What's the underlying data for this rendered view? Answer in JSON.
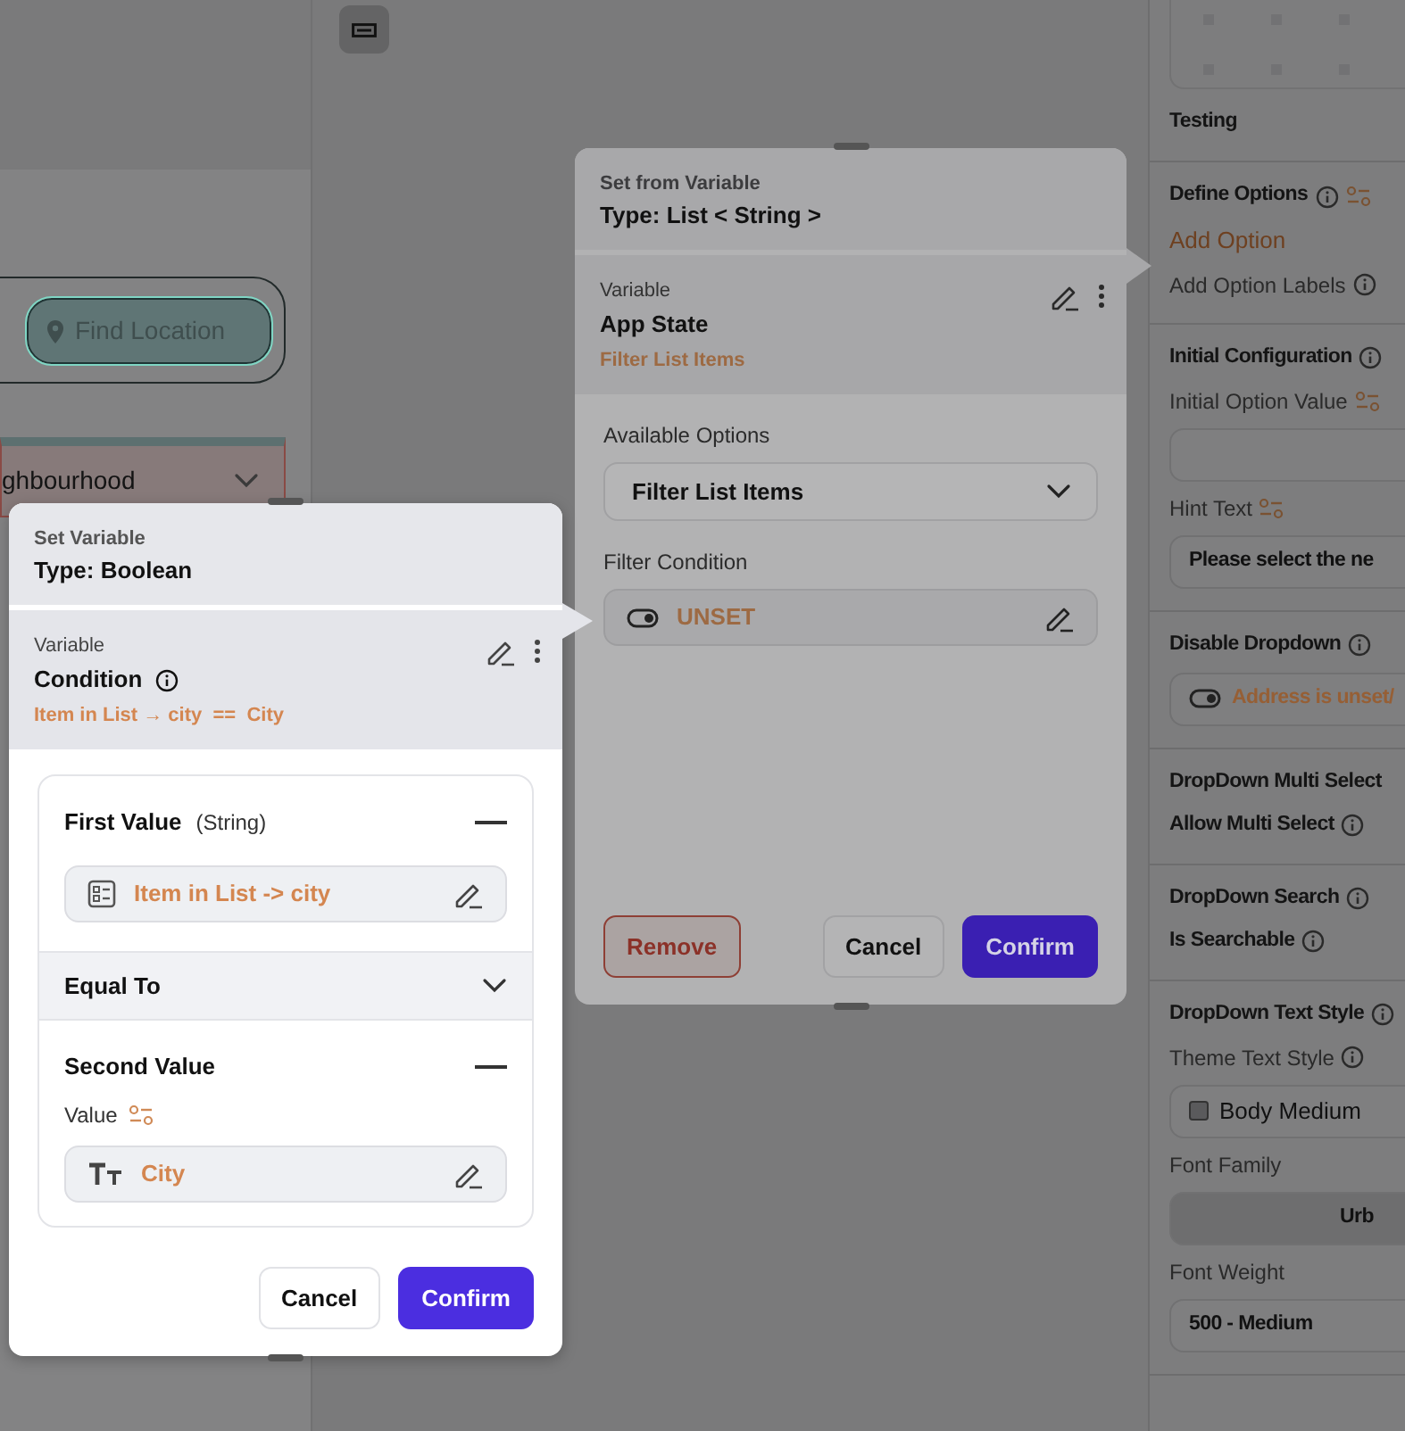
{
  "canvas": {
    "find_location_button": "Find Location",
    "dropdown": {
      "value": "ghbourhood"
    }
  },
  "properties_panel": {
    "sections": [
      {
        "items": [
          {
            "kind": "heading",
            "text": "Testing"
          }
        ]
      },
      {
        "items": [
          {
            "kind": "heading",
            "text": "Define Options",
            "info": true,
            "options_icon": true
          },
          {
            "kind": "link",
            "text": "Add Option"
          },
          {
            "kind": "label",
            "text": "Add Option Labels",
            "info": true
          }
        ]
      },
      {
        "items": [
          {
            "kind": "heading",
            "text": "Initial Configuration",
            "info": true
          },
          {
            "kind": "label",
            "text": "Initial Option Value",
            "options_icon": true
          },
          {
            "kind": "field"
          },
          {
            "kind": "label",
            "text": "Hint Text",
            "options_icon": true
          },
          {
            "kind": "field",
            "text": "Please select the ne"
          }
        ]
      },
      {
        "items": [
          {
            "kind": "heading",
            "text": "Disable Dropdown",
            "info": true
          },
          {
            "kind": "toggle_field",
            "text": "Address is unset/"
          }
        ]
      },
      {
        "items": [
          {
            "kind": "heading",
            "text": "DropDown Multi Select"
          },
          {
            "kind": "heading",
            "text": "Allow Multi Select",
            "info": true
          }
        ]
      },
      {
        "items": [
          {
            "kind": "heading",
            "text": "DropDown Search",
            "info": true
          },
          {
            "kind": "heading",
            "text": "Is Searchable",
            "info": true
          }
        ]
      },
      {
        "items": [
          {
            "kind": "heading",
            "text": "DropDown Text Style",
            "info": true
          },
          {
            "kind": "label",
            "text": "Theme Text Style",
            "info": true
          },
          {
            "kind": "swatch_field",
            "text": "Body Medium"
          },
          {
            "kind": "label",
            "text": "Font Family"
          },
          {
            "kind": "button_field",
            "text": "Urb"
          },
          {
            "kind": "label",
            "text": "Font Weight"
          },
          {
            "kind": "field",
            "text": "500 - Medium"
          }
        ]
      }
    ]
  },
  "set_from_variable_dialog": {
    "subtitle": "Set from Variable",
    "type": "Type: List < String >",
    "variable": {
      "label": "Variable",
      "name": "App State",
      "value": "Filter List Items"
    },
    "fields": [
      {
        "kind": "select",
        "label": "Available Options",
        "value": "Filter List Items"
      },
      {
        "kind": "toggle",
        "label": "Filter Condition",
        "value": "UNSET"
      }
    ],
    "buttons": [
      {
        "kind": "danger",
        "label": "Remove"
      },
      {
        "kind": "secondary",
        "label": "Cancel"
      },
      {
        "kind": "primary",
        "label": "Confirm"
      }
    ]
  },
  "set_variable_dialog": {
    "subtitle": "Set Variable",
    "type": "Type: Boolean",
    "variable": {
      "label": "Variable",
      "name": "Condition",
      "info": true,
      "value": "Item in List → city  ==  City"
    },
    "first_value": {
      "title": "First Value",
      "type_hint": "(String)",
      "value": "Item in List -> city"
    },
    "operator": "Equal To",
    "second_value": {
      "title": "Second Value",
      "label": "Value",
      "value": "City"
    },
    "buttons": [
      {
        "kind": "secondary",
        "label": "Cancel"
      },
      {
        "kind": "primary",
        "label": "Confirm"
      }
    ]
  }
}
